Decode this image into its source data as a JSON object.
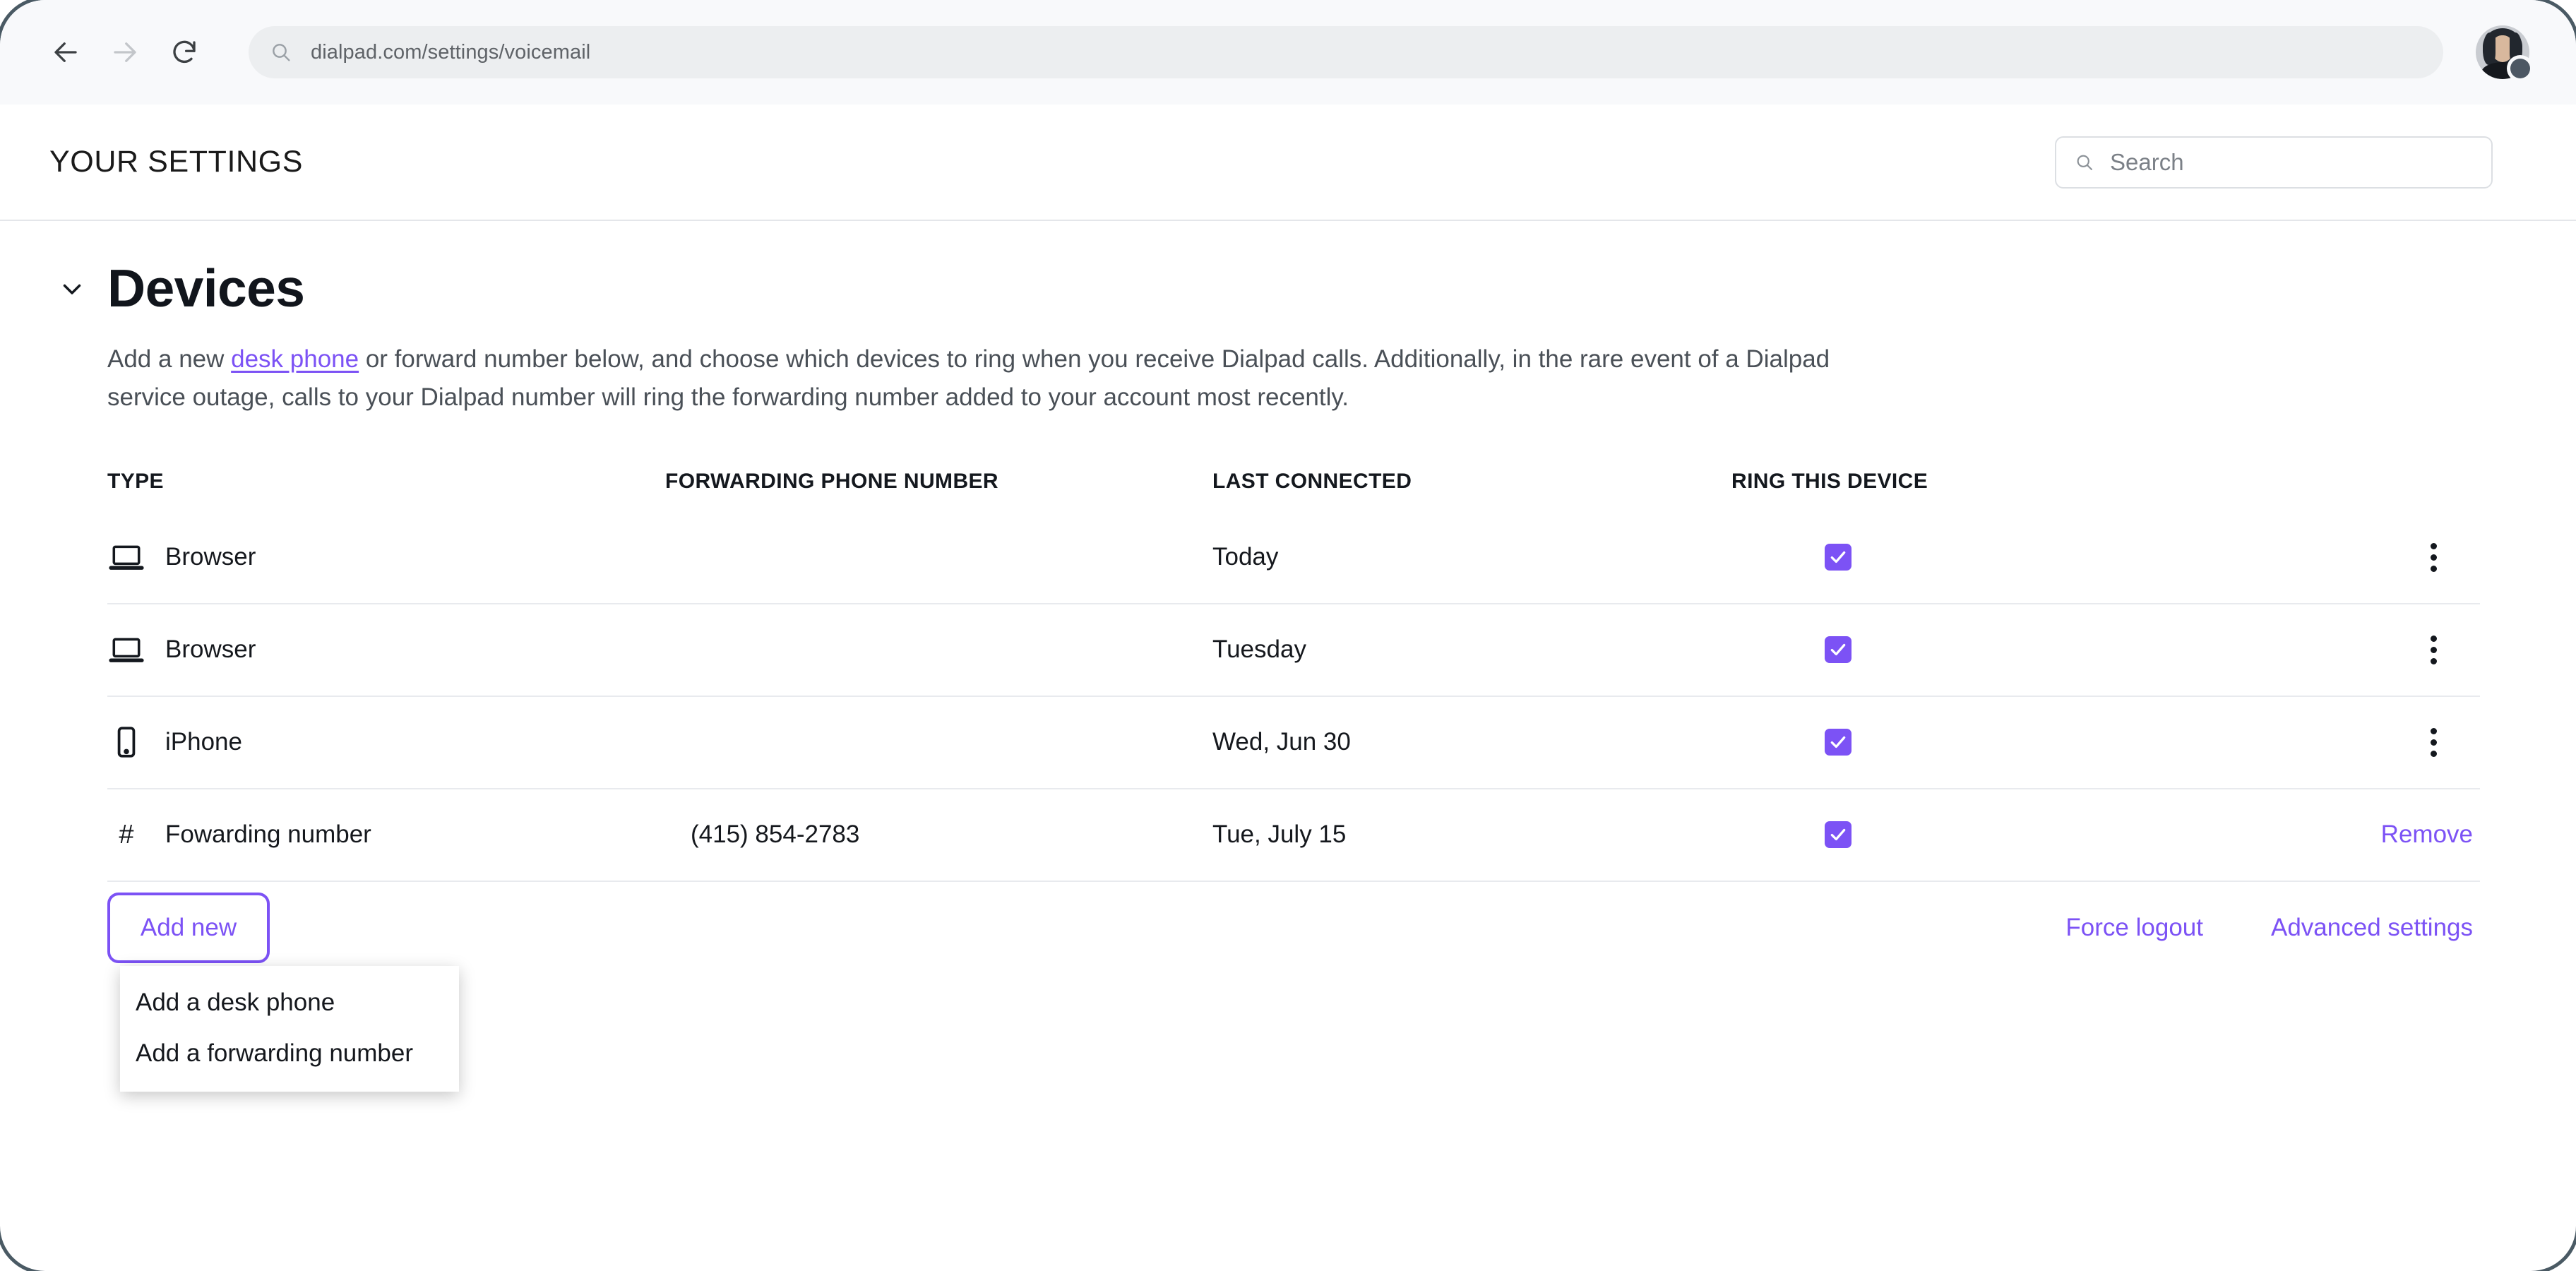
{
  "browser": {
    "back_icon": "arrow-left-icon",
    "forward_icon": "arrow-right-icon",
    "reload_icon": "reload-icon",
    "url": "dialpad.com/settings/voicemail",
    "url_search_icon": "search-icon",
    "avatar_name": "user-avatar",
    "avatar_status": "status-badge"
  },
  "header": {
    "title": "YOUR SETTINGS",
    "search": {
      "placeholder": "Search",
      "icon": "search-icon"
    }
  },
  "section": {
    "collapse_icon": "chevron-down-icon",
    "title": "Devices",
    "description_part1": "Add a new ",
    "description_link": "desk phone",
    "description_part2": " or forward number below, and choose which devices to ring when you receive Dialpad calls. Additionally, in the rare event of a Dialpad service outage, calls to your Dialpad number will ring the forwarding number added to your account most recently."
  },
  "table": {
    "columns": [
      {
        "key": "type",
        "label": "TYPE"
      },
      {
        "key": "forwarding",
        "label": "FORWARDING PHONE NUMBER"
      },
      {
        "key": "last_connected",
        "label": "LAST CONNECTED"
      },
      {
        "key": "ring",
        "label": "RING THIS DEVICE"
      }
    ],
    "rows": [
      {
        "icon": "laptop-icon",
        "type": "Browser",
        "forwarding": "",
        "last_connected": "Today",
        "ring_checked": true,
        "action": "kebab",
        "action_label": ""
      },
      {
        "icon": "laptop-icon",
        "type": "Browser",
        "forwarding": "",
        "last_connected": "Tuesday",
        "ring_checked": true,
        "action": "kebab",
        "action_label": ""
      },
      {
        "icon": "mobile-phone-icon",
        "type": "iPhone",
        "forwarding": "",
        "last_connected": "Wed, Jun 30",
        "ring_checked": true,
        "action": "kebab",
        "action_label": ""
      },
      {
        "icon": "hash-icon",
        "type": "Fowarding number",
        "forwarding": "(415) 854-2783",
        "last_connected": "Tue, July 15",
        "ring_checked": true,
        "action": "remove",
        "action_label": "Remove"
      }
    ]
  },
  "footer": {
    "add_new_label": "Add new",
    "dropdown": {
      "open": true,
      "items": [
        "Add a desk phone",
        "Add a forwarding number"
      ]
    },
    "force_logout_label": "Force logout",
    "advanced_settings_label": "Advanced settings"
  },
  "colors": {
    "accent_purple": "#7C52F5",
    "text_dark": "#15181D",
    "text_muted": "#4A5057",
    "divider": "#E8EAEE",
    "chrome_bg": "#F8F9FB",
    "url_bg": "#ECEEF0",
    "window_border": "#4A5A64"
  }
}
